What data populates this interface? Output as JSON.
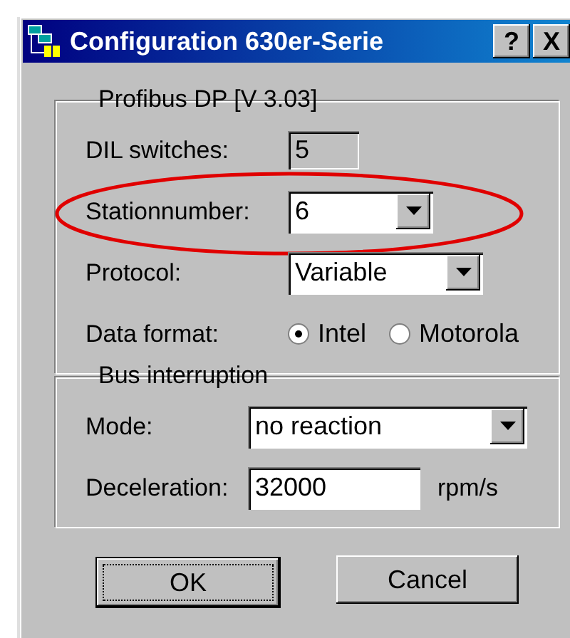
{
  "window": {
    "title": "Configuration 630er-Serie",
    "title_buttons": [
      "?",
      "X"
    ]
  },
  "groups": [
    {
      "title": "Profibus DP [V 3.03]",
      "rows": [
        {
          "kind": "field",
          "label": "DIL switches:",
          "value": "5",
          "disabled": true
        },
        {
          "kind": "combo",
          "label": "Stationnumber:",
          "value": "6",
          "highlighted": true
        },
        {
          "kind": "combo",
          "label": "Protocol:",
          "value": "Variable"
        },
        {
          "kind": "radio",
          "label": "Data format:",
          "options": [
            {
              "label": "Intel",
              "selected": true
            },
            {
              "label": "Motorola",
              "selected": false
            }
          ]
        }
      ]
    },
    {
      "title": "Bus interruption",
      "rows": [
        {
          "kind": "combo",
          "label": "Mode:",
          "value": "no reaction"
        },
        {
          "kind": "field",
          "label": "Deceleration:",
          "value": "32000",
          "unit": "rpm/s",
          "disabled": false
        }
      ]
    }
  ],
  "buttons": [
    {
      "label": "OK",
      "default": true
    },
    {
      "label": "Cancel",
      "default": false
    }
  ]
}
